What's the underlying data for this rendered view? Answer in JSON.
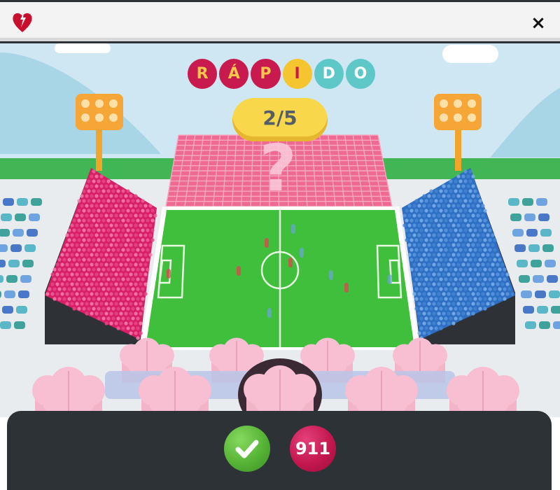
{
  "header": {
    "logo_icon": "heart-torch-logo-icon",
    "close_label": "×",
    "close_icon": "close-icon"
  },
  "title": {
    "letters": [
      "R",
      "Á",
      "P",
      "I",
      "D",
      "O"
    ],
    "colors": [
      "red",
      "red",
      "red",
      "yellow",
      "teal",
      "teal"
    ]
  },
  "progress": {
    "label": "2/5",
    "current": 2,
    "total": 5
  },
  "scene": {
    "question_mark": "?",
    "left_stand_color": "#d61f66",
    "right_stand_color": "#2f6fc3",
    "field_color": "#3fbf3b",
    "sky_color": "#cfe7f2"
  },
  "actions": {
    "check_icon": "checkmark-icon",
    "emergency_label": "911"
  },
  "colors": {
    "brand_red": "#c81a4f",
    "accent_yellow": "#f8d74a",
    "accent_teal": "#5ec8c9",
    "button_green": "#55b335",
    "bar_dark": "#2d3237"
  }
}
